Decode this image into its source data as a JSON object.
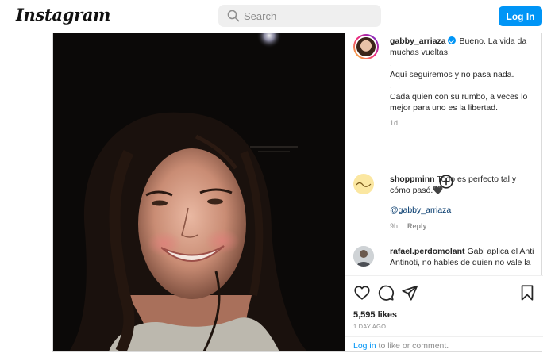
{
  "header": {
    "logo": "Instagram",
    "search_placeholder": "Search",
    "login_label": "Log In"
  },
  "post": {
    "author": "gabby_arriaza",
    "caption_lines": [
      "Bueno. La vida da muchas vueltas.",
      ".",
      "Aquí seguiremos y no pasa nada.",
      ".",
      "Cada quien con su rumbo, a veces lo mejor para uno es la libertad."
    ],
    "caption_time": "1d",
    "likes": "5,595 likes",
    "date": "1 DAY AGO",
    "login_prompt_link": "Log in",
    "login_prompt_rest": " to like or comment."
  },
  "comments": [
    {
      "user": "shoppminn",
      "text": "Todo es perfecto tal y cómo pasó.🖤",
      "mention": "@gabby_arriaza",
      "time": "9h",
      "reply": "Reply"
    },
    {
      "user": "rafael.perdomolant",
      "text": "Gabi aplica el Anti Antinoti, no hables de quien no vale la"
    }
  ],
  "icons": {
    "search": "search-icon",
    "verified": "verified-badge-icon",
    "more_comments": "plus-circle-icon",
    "like": "heart-icon",
    "comment": "comment-icon",
    "share": "share-icon",
    "save": "bookmark-icon"
  },
  "colors": {
    "accent": "#0095f6",
    "text": "#262626",
    "muted": "#8e8e8e",
    "mention": "#00376b"
  }
}
